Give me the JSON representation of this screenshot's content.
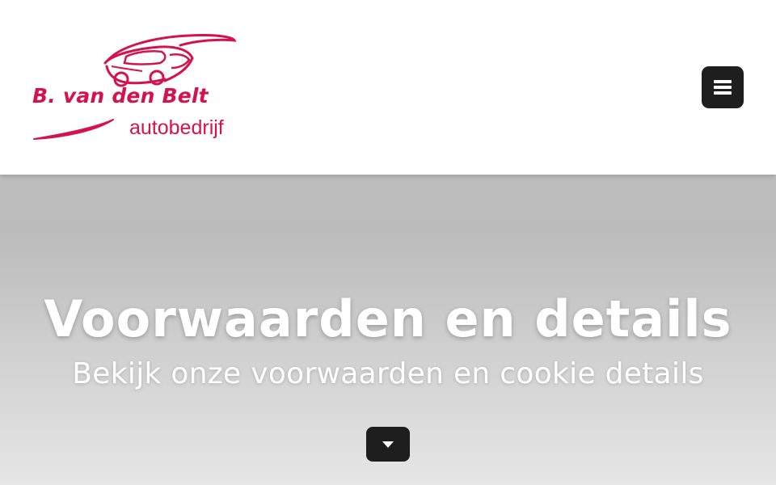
{
  "header": {
    "logo": {
      "name": "B. van den Belt",
      "tagline": "autobedrijf",
      "icon": "car-logo-icon"
    },
    "menu_button": {
      "icon": "hamburger-menu-icon"
    }
  },
  "hero": {
    "title": "Voorwaarden en details",
    "subtitle": "Bekijk onze voorwaarden en cookie details",
    "scroll_button": {
      "icon": "caret-down-icon"
    }
  },
  "colors": {
    "brand": "#d4124e",
    "button_bg": "#1e1e1e",
    "hero_text": "#ffffff",
    "header_bg": "#ffffff"
  }
}
